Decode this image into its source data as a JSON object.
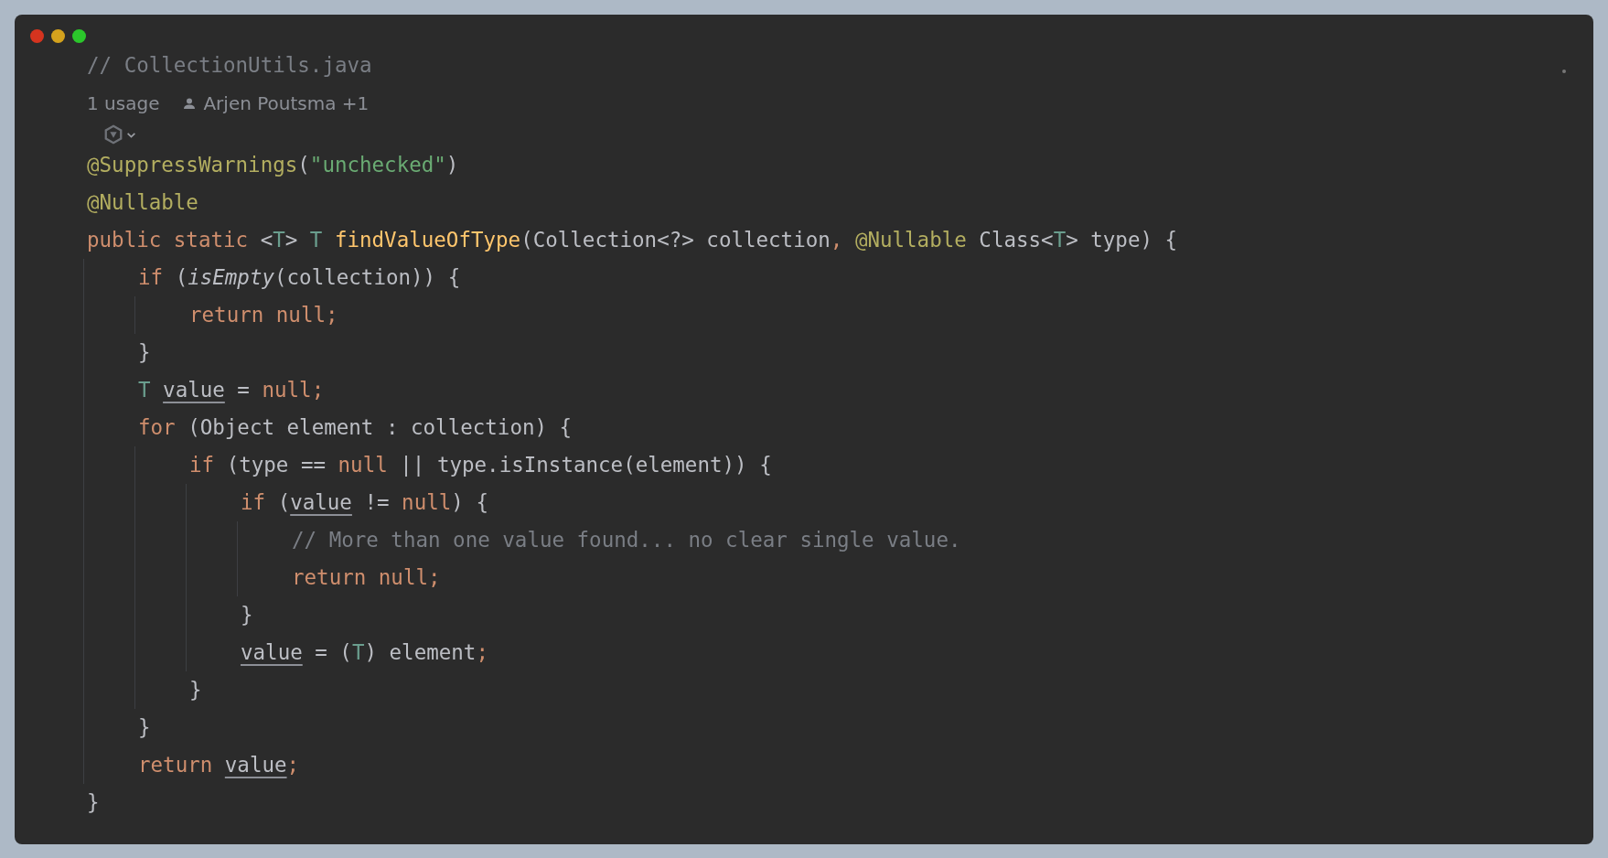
{
  "window": {
    "controls": [
      {
        "color": "#d5341f"
      },
      {
        "color": "#d4a21d"
      },
      {
        "color": "#2bc62b"
      }
    ]
  },
  "file_comment": "// CollectionUtils.java",
  "inlay": {
    "usages": "1 usage",
    "author": "Arjen Poutsma +1"
  },
  "code": [
    {
      "tokens": [
        {
          "kind": "annotation",
          "text": "@SuppressWarnings"
        },
        {
          "kind": "plain",
          "text": "("
        },
        {
          "kind": "string",
          "text": "\"unchecked\""
        },
        {
          "kind": "plain",
          "text": ")"
        }
      ]
    },
    {
      "tokens": [
        {
          "kind": "annotation",
          "text": "@Nullable"
        }
      ]
    },
    {
      "tokens": [
        {
          "kind": "keyword",
          "text": "public static "
        },
        {
          "kind": "plain",
          "text": "<"
        },
        {
          "kind": "type_param",
          "text": "T"
        },
        {
          "kind": "plain",
          "text": "> "
        },
        {
          "kind": "type_param",
          "text": "T "
        },
        {
          "kind": "method",
          "text": "findValueOfType"
        },
        {
          "kind": "plain",
          "text": "(Collection<?> collection"
        },
        {
          "kind": "keyword",
          "text": ", "
        },
        {
          "kind": "annotation",
          "text": "@Nullable "
        },
        {
          "kind": "plain",
          "text": "Class<"
        },
        {
          "kind": "type_param",
          "text": "T"
        },
        {
          "kind": "plain",
          "text": "> type) {"
        }
      ],
      "close": "}",
      "children": [
        {
          "tokens": [
            {
              "kind": "keyword",
              "text": "if "
            },
            {
              "kind": "plain",
              "text": "("
            },
            {
              "kind": "static_call",
              "text": "isEmpty"
            },
            {
              "kind": "plain",
              "text": "(collection)) {"
            }
          ],
          "close": "}",
          "children": [
            {
              "tokens": [
                {
                  "kind": "keyword",
                  "text": "return null;"
                }
              ]
            }
          ]
        },
        {
          "tokens": [
            {
              "kind": "type_param",
              "text": "T "
            },
            {
              "kind": "reassigned",
              "text": "value"
            },
            {
              "kind": "plain",
              "text": " = "
            },
            {
              "kind": "keyword",
              "text": "null;"
            }
          ]
        },
        {
          "tokens": [
            {
              "kind": "keyword",
              "text": "for "
            },
            {
              "kind": "plain",
              "text": "(Object element : collection) {"
            }
          ],
          "close": "}",
          "children": [
            {
              "tokens": [
                {
                  "kind": "keyword",
                  "text": "if "
                },
                {
                  "kind": "plain",
                  "text": "(type == "
                },
                {
                  "kind": "keyword",
                  "text": "null"
                },
                {
                  "kind": "plain",
                  "text": " || type.isInstance(element)) {"
                }
              ],
              "close": "}",
              "children": [
                {
                  "tokens": [
                    {
                      "kind": "keyword",
                      "text": "if "
                    },
                    {
                      "kind": "plain",
                      "text": "("
                    },
                    {
                      "kind": "reassigned",
                      "text": "value"
                    },
                    {
                      "kind": "plain",
                      "text": " != "
                    },
                    {
                      "kind": "keyword",
                      "text": "null"
                    },
                    {
                      "kind": "plain",
                      "text": ") {"
                    }
                  ],
                  "close": "}",
                  "children": [
                    {
                      "tokens": [
                        {
                          "kind": "comment",
                          "text": "// More than one value found... no clear single value."
                        }
                      ]
                    },
                    {
                      "tokens": [
                        {
                          "kind": "keyword",
                          "text": "return null;"
                        }
                      ]
                    }
                  ]
                },
                {
                  "tokens": [
                    {
                      "kind": "reassigned",
                      "text": "value"
                    },
                    {
                      "kind": "plain",
                      "text": " = ("
                    },
                    {
                      "kind": "type_param",
                      "text": "T"
                    },
                    {
                      "kind": "plain",
                      "text": ") element"
                    },
                    {
                      "kind": "keyword",
                      "text": ";"
                    }
                  ]
                }
              ]
            }
          ]
        },
        {
          "tokens": [
            {
              "kind": "keyword",
              "text": "return "
            },
            {
              "kind": "reassigned",
              "text": "value"
            },
            {
              "kind": "keyword",
              "text": ";"
            }
          ]
        }
      ]
    }
  ]
}
